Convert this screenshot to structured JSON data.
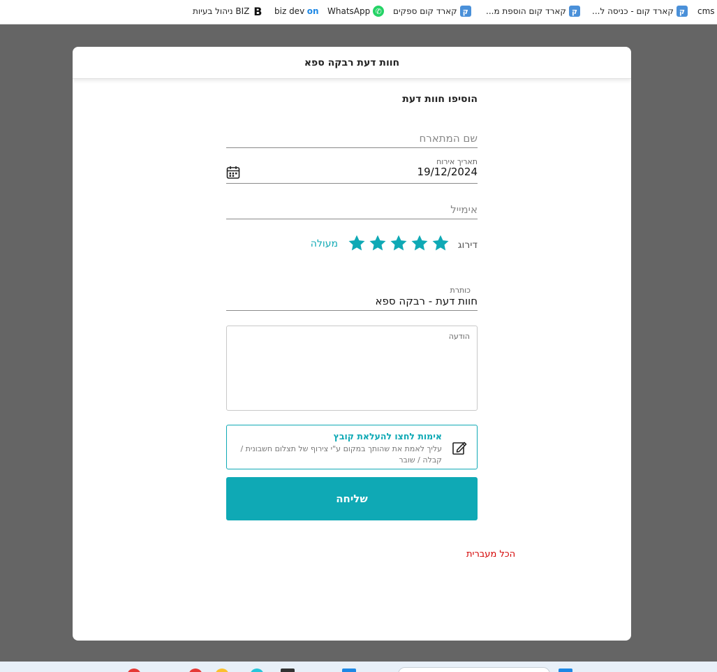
{
  "bookmarks": [
    {
      "label": "cms B",
      "icon": "cms-icon"
    },
    {
      "label": "קארד קום - כניסה ל...",
      "icon": "cardcom-icon"
    },
    {
      "label": "קארד קום הוספת מ...",
      "icon": "cardcom-icon"
    },
    {
      "label": "קארד קום ספקים",
      "icon": "cardcom-icon"
    },
    {
      "label": "WhatsApp",
      "icon": "whatsapp-icon"
    },
    {
      "label": "biz dev",
      "icon": "on-icon"
    },
    {
      "label": "ניהול בעיות BIZ",
      "icon": "b-icon"
    }
  ],
  "modal": {
    "title": "חוות דעת רבקה ספא"
  },
  "form": {
    "section_title": "הוסיפו חוות דעת",
    "name_placeholder": "שם המתארח",
    "date_label": "תאריך אירוח",
    "date_value": "19/12/2024",
    "email_placeholder": "אימייל",
    "rating_label": "דירוג",
    "rating_value": 5,
    "rating_max": 5,
    "rating_text": "מעולה",
    "title_label": "כותרת",
    "title_value": "חוות דעת - רבקה ספא",
    "message_label": "הודעה",
    "upload_title": "אימות לחצו להעלאת קובץ",
    "upload_desc": "עליך לאמת את שהותך במקום ע\"י צירוף של תצלום חשבונית / קבלה / שובר",
    "submit_label": "שליחה",
    "language_link": "הכל מעברית"
  },
  "colors": {
    "accent": "#0fa9b5",
    "link_red": "#d40000",
    "backdrop": "#656565"
  }
}
